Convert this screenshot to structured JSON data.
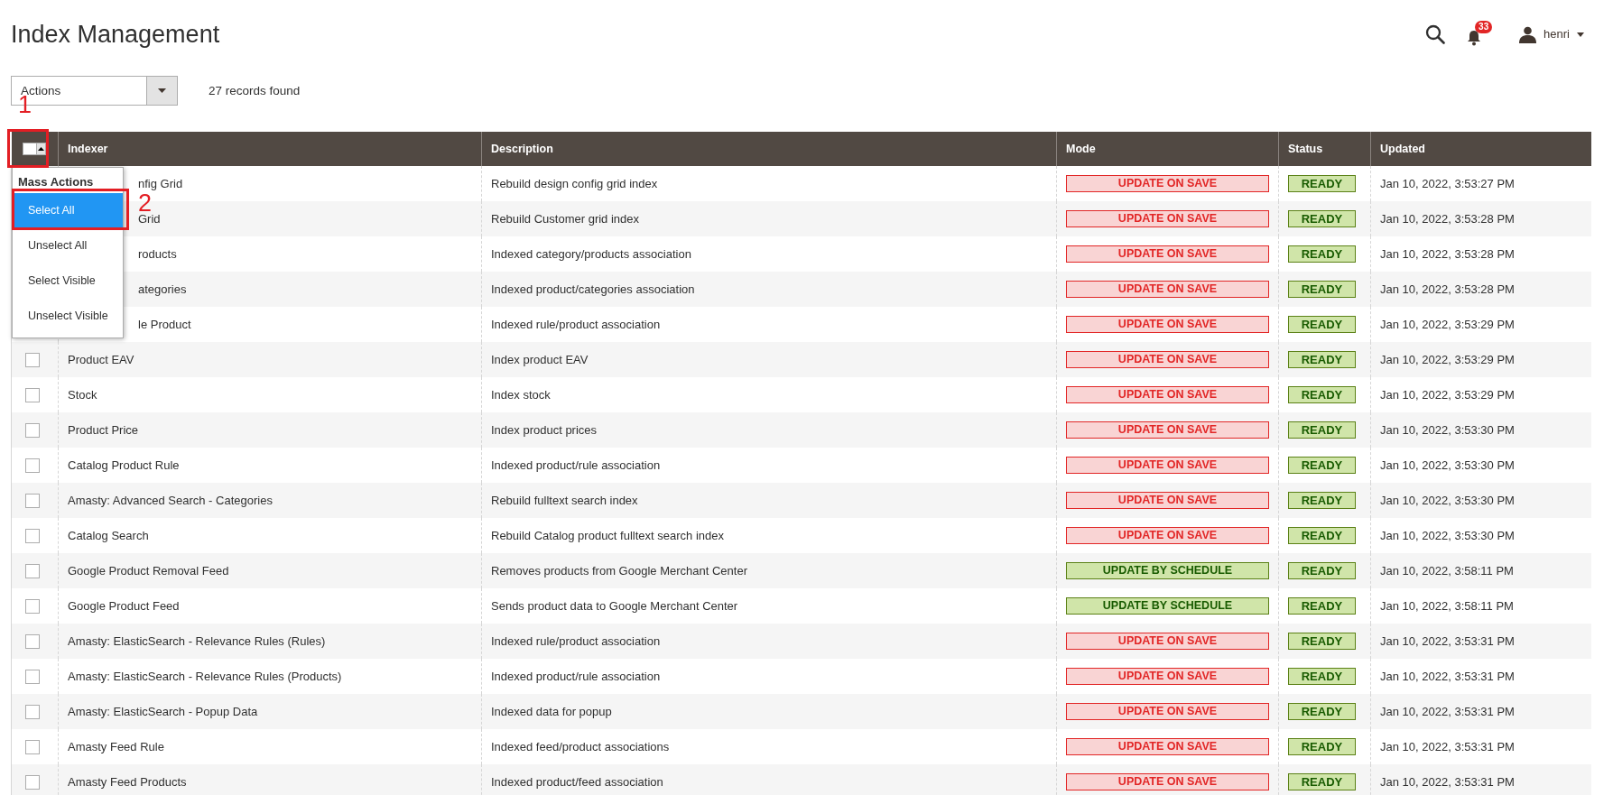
{
  "page": {
    "title": "Index Management"
  },
  "header": {
    "notifications": "33",
    "user": "henri"
  },
  "toolbar": {
    "actions": "Actions",
    "records": "27 records found"
  },
  "table": {
    "select_all_checked": false,
    "columns": [
      "Indexer",
      "Description",
      "Mode",
      "Status",
      "Updated"
    ],
    "rows": [
      {
        "indexer": "nfig Grid",
        "description": "Rebuild design config grid index",
        "mode": "UPDATE ON SAVE",
        "kind": "save",
        "status": "READY",
        "updated": "Jan 10, 2022, 3:53:27 PM"
      },
      {
        "indexer": "Grid",
        "description": "Rebuild Customer grid index",
        "mode": "UPDATE ON SAVE",
        "kind": "save",
        "status": "READY",
        "updated": "Jan 10, 2022, 3:53:28 PM"
      },
      {
        "indexer": "roducts",
        "description": "Indexed category/products association",
        "mode": "UPDATE ON SAVE",
        "kind": "save",
        "status": "READY",
        "updated": "Jan 10, 2022, 3:53:28 PM"
      },
      {
        "indexer": "ategories",
        "description": "Indexed product/categories association",
        "mode": "UPDATE ON SAVE",
        "kind": "save",
        "status": "READY",
        "updated": "Jan 10, 2022, 3:53:28 PM"
      },
      {
        "indexer": "le Product",
        "description": "Indexed rule/product association",
        "mode": "UPDATE ON SAVE",
        "kind": "save",
        "status": "READY",
        "updated": "Jan 10, 2022, 3:53:29 PM"
      },
      {
        "checked": false,
        "indexer": "Product EAV",
        "description": "Index product EAV",
        "mode": "UPDATE ON SAVE",
        "kind": "save",
        "status": "READY",
        "updated": "Jan 10, 2022, 3:53:29 PM"
      },
      {
        "checked": false,
        "indexer": "Stock",
        "description": "Index stock",
        "mode": "UPDATE ON SAVE",
        "kind": "save",
        "status": "READY",
        "updated": "Jan 10, 2022, 3:53:29 PM"
      },
      {
        "checked": false,
        "indexer": "Product Price",
        "description": "Index product prices",
        "mode": "UPDATE ON SAVE",
        "kind": "save",
        "status": "READY",
        "updated": "Jan 10, 2022, 3:53:30 PM"
      },
      {
        "checked": false,
        "indexer": "Catalog Product Rule",
        "description": "Indexed product/rule association",
        "mode": "UPDATE ON SAVE",
        "kind": "save",
        "status": "READY",
        "updated": "Jan 10, 2022, 3:53:30 PM"
      },
      {
        "checked": false,
        "indexer": "Amasty: Advanced Search - Categories",
        "description": "Rebuild fulltext search index",
        "mode": "UPDATE ON SAVE",
        "kind": "save",
        "status": "READY",
        "updated": "Jan 10, 2022, 3:53:30 PM"
      },
      {
        "checked": false,
        "indexer": "Catalog Search",
        "description": "Rebuild Catalog product fulltext search index",
        "mode": "UPDATE ON SAVE",
        "kind": "save",
        "status": "READY",
        "updated": "Jan 10, 2022, 3:53:30 PM"
      },
      {
        "checked": false,
        "indexer": "Google Product Removal Feed",
        "description": "Removes products from Google Merchant Center",
        "mode": "UPDATE BY SCHEDULE",
        "kind": "schedule",
        "status": "READY",
        "updated": "Jan 10, 2022, 3:58:11 PM"
      },
      {
        "checked": false,
        "indexer": "Google Product Feed",
        "description": "Sends product data to Google Merchant Center",
        "mode": "UPDATE BY SCHEDULE",
        "kind": "schedule",
        "status": "READY",
        "updated": "Jan 10, 2022, 3:58:11 PM"
      },
      {
        "checked": false,
        "indexer": "Amasty: ElasticSearch - Relevance Rules (Rules)",
        "description": "Indexed rule/product association",
        "mode": "UPDATE ON SAVE",
        "kind": "save",
        "status": "READY",
        "updated": "Jan 10, 2022, 3:53:31 PM"
      },
      {
        "checked": false,
        "indexer": "Amasty: ElasticSearch - Relevance Rules (Products)",
        "description": "Indexed product/rule association",
        "mode": "UPDATE ON SAVE",
        "kind": "save",
        "status": "READY",
        "updated": "Jan 10, 2022, 3:53:31 PM"
      },
      {
        "checked": false,
        "indexer": "Amasty: ElasticSearch - Popup Data",
        "description": "Indexed data for popup",
        "mode": "UPDATE ON SAVE",
        "kind": "save",
        "status": "READY",
        "updated": "Jan 10, 2022, 3:53:31 PM"
      },
      {
        "checked": false,
        "indexer": "Amasty Feed Rule",
        "description": "Indexed feed/product associations",
        "mode": "UPDATE ON SAVE",
        "kind": "save",
        "status": "READY",
        "updated": "Jan 10, 2022, 3:53:31 PM"
      },
      {
        "checked": false,
        "indexer": "Amasty Feed Products",
        "description": "Indexed product/feed association",
        "mode": "UPDATE ON SAVE",
        "kind": "save",
        "status": "READY",
        "updated": "Jan 10, 2022, 3:53:31 PM"
      }
    ]
  },
  "mass_actions_menu": {
    "title": "Mass Actions",
    "items": [
      {
        "label": "Select All",
        "selected": true
      },
      {
        "label": "Unselect All",
        "selected": false
      },
      {
        "label": "Select Visible",
        "selected": false
      },
      {
        "label": "Unselect Visible",
        "selected": false
      }
    ]
  },
  "annotations": [
    "1",
    "2"
  ]
}
